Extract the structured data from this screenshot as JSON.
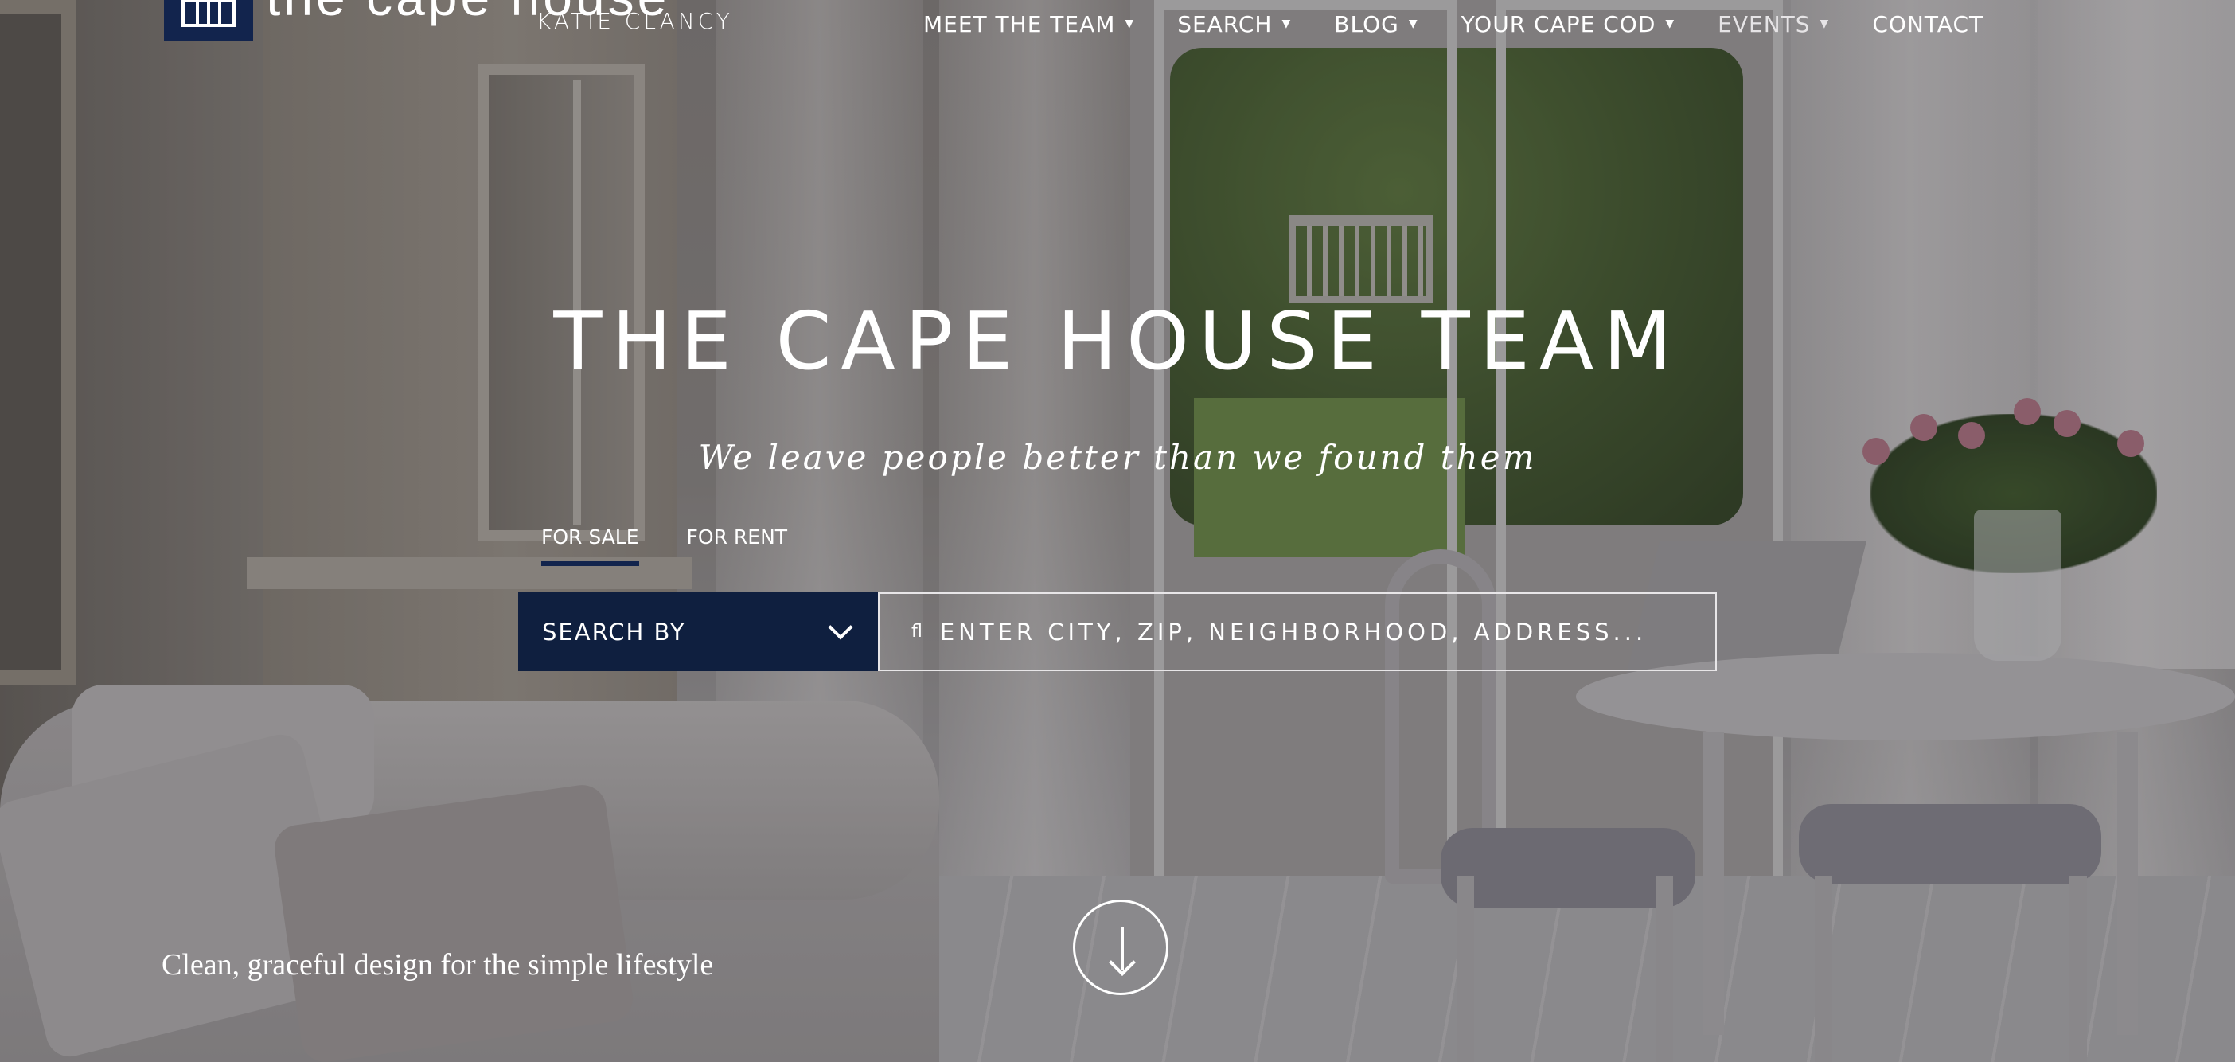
{
  "header": {
    "logo_title": "the cape house",
    "logo_subtitle": "KATIE CLANCY",
    "logo_icon": "bench-icon"
  },
  "nav": {
    "items": [
      {
        "label": "MEET THE TEAM",
        "has_dropdown": true
      },
      {
        "label": "SEARCH",
        "has_dropdown": true
      },
      {
        "label": "BLOG",
        "has_dropdown": true
      },
      {
        "label": "YOUR CAPE COD",
        "has_dropdown": true
      },
      {
        "label": "EVENTS",
        "has_dropdown": true
      },
      {
        "label": "CONTACT",
        "has_dropdown": false
      }
    ],
    "caret": "▼"
  },
  "hero": {
    "title": "THE CAPE HOUSE TEAM",
    "tagline": "We leave people better than we found them"
  },
  "search": {
    "tabs": [
      {
        "label": "FOR SALE",
        "active": true
      },
      {
        "label": "FOR RENT",
        "active": false
      }
    ],
    "search_by_label": "SEARCH BY",
    "placeholder": "ENTER CITY, ZIP, NEIGHBORHOOD, ADDRESS...",
    "icon_glyph": "ﬂ"
  },
  "footer_tagline": "Clean, graceful design for the simple lifestyle",
  "colors": {
    "navy": "#0f1f3f",
    "text": "#ffffff"
  }
}
